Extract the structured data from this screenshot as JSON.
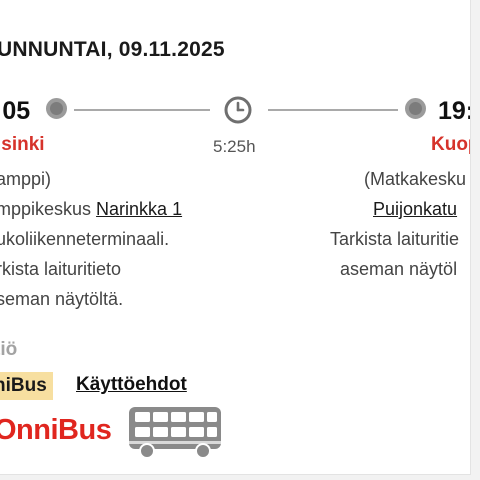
{
  "trip": {
    "date": "UNNUNTAI, 09.11.2025",
    "departure": {
      "time": ":05",
      "city": "lsinki",
      "lines": [
        "amppi)"
      ],
      "stop_prefix": "mppikeskus ",
      "stop_link": "Narinkka 1",
      "notes": [
        "ukoliikenneterminaali.",
        "rkista laituritieto",
        "seman näytöltä."
      ]
    },
    "duration": "5:25h",
    "arrival": {
      "time": "19:3",
      "city": "Kuop",
      "lines": [
        "(Matkakesku"
      ],
      "stop_link": "Puijonkatu",
      "notes": [
        "Tarkista laituritie",
        "aseman näytöl"
      ]
    }
  },
  "operator": {
    "section_label": "tiö",
    "name_chip": "niBus",
    "terms_link": "Käyttöehdot",
    "logo_text": "OnniBus"
  },
  "colors": {
    "accent": "#d6332b",
    "logo_red": "#e0261f",
    "chip_bg": "#f7dfa0",
    "muted": "#a3a3a3"
  },
  "icons": {
    "clock": "clock-icon",
    "bus": "double-decker-bus-icon",
    "stop_dot": "stop-dot-icon"
  }
}
